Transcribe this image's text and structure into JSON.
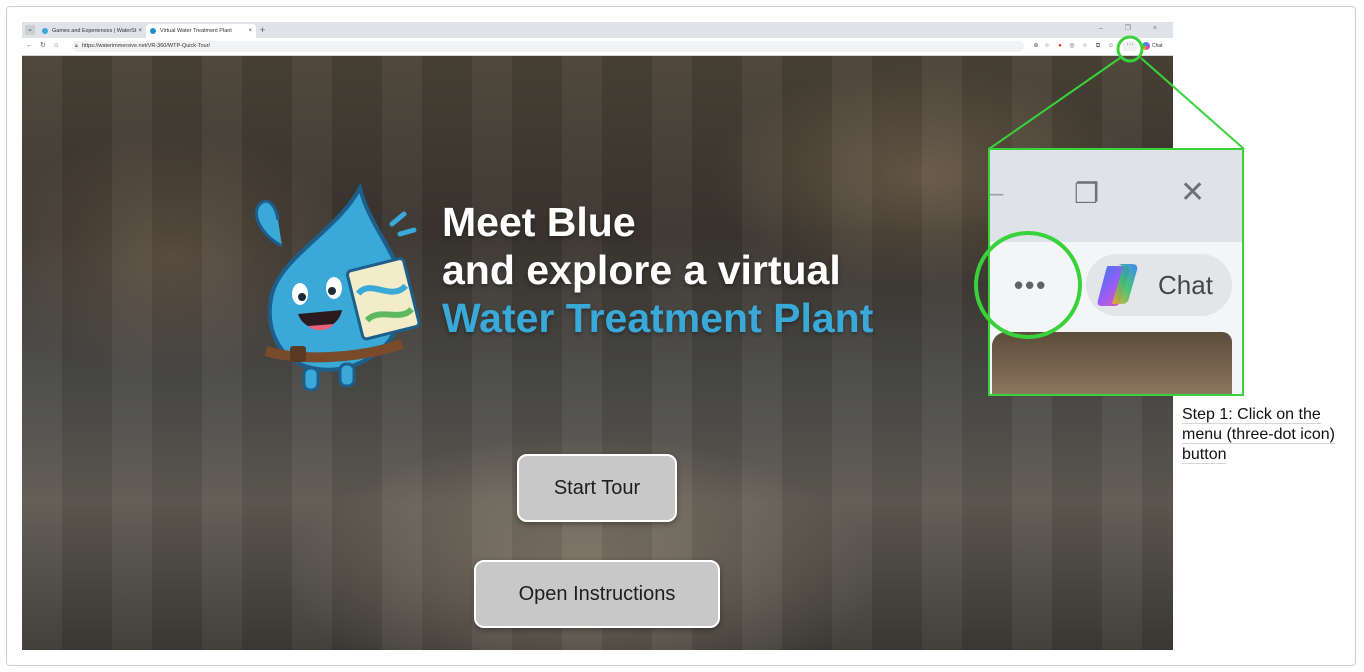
{
  "browser": {
    "tabs": [
      {
        "label": "Games and Experiences | WaterSt",
        "close": "×"
      },
      {
        "label": "Virtual Water Treatment Plant",
        "close": "×"
      }
    ],
    "tab_menu_icon": "chevron-down-icon",
    "new_tab_label": "+",
    "window_controls": "– ❐ ×",
    "url": "https://waterimmersive.net/VR-360/WTP-Quick-Tour/",
    "toolbar_chat_label": "Chat",
    "toolbar_menu_label": "···"
  },
  "page": {
    "headline_line1": "Meet Blue",
    "headline_line2": "and explore a virtual",
    "headline_line3": "Water Treatment Plant",
    "start_button": "Start Tour",
    "instructions_button": "Open Instructions",
    "accent_color": "#3aa9d8"
  },
  "callout": {
    "zoom_minimize": "–",
    "zoom_restore": "❐",
    "zoom_close": "✕",
    "zoom_menu_dots": "•••",
    "zoom_chat_label": "Chat",
    "highlight_color": "#39d23a",
    "caption": "Step 1: Click on the menu (three-dot icon) button"
  }
}
